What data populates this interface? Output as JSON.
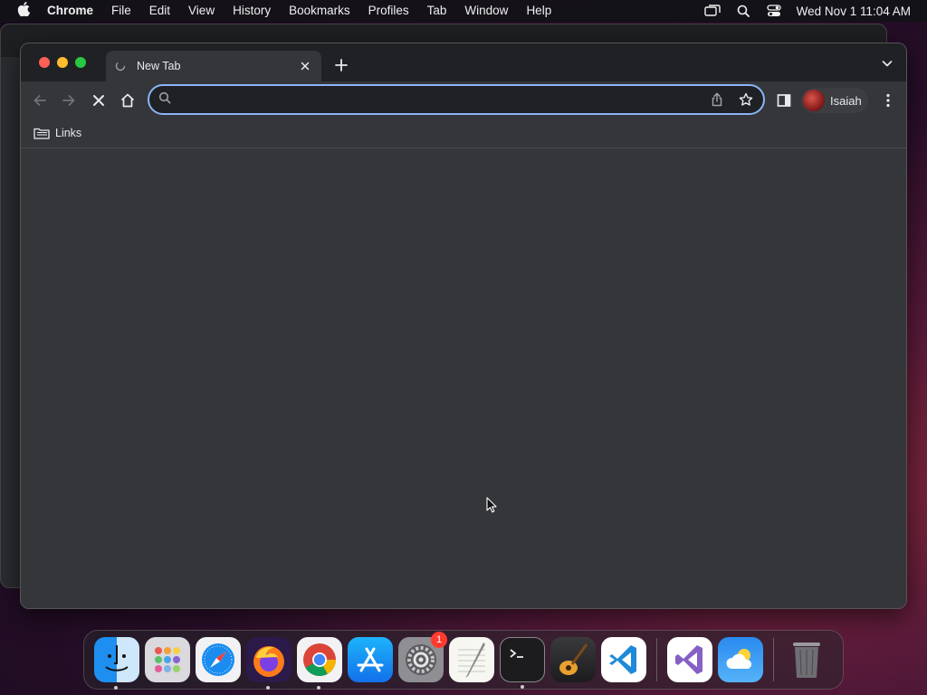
{
  "menubar": {
    "app_name": "Chrome",
    "items": [
      "File",
      "Edit",
      "View",
      "History",
      "Bookmarks",
      "Profiles",
      "Tab",
      "Window",
      "Help"
    ],
    "clock": "Wed Nov 1  11:04 AM"
  },
  "tab": {
    "title": "New Tab"
  },
  "omnibox": {
    "value": "",
    "placeholder": ""
  },
  "profile": {
    "name": "Isaiah"
  },
  "bookmarks": {
    "items": [
      {
        "label": "Links"
      }
    ]
  },
  "dock": {
    "apps": [
      {
        "name": "finder",
        "running": true
      },
      {
        "name": "launchpad",
        "running": false
      },
      {
        "name": "safari",
        "running": false
      },
      {
        "name": "firefox",
        "running": true
      },
      {
        "name": "chrome",
        "running": true
      },
      {
        "name": "app-store",
        "running": false
      },
      {
        "name": "system-settings",
        "running": false,
        "badge": "1"
      },
      {
        "name": "textedit",
        "running": false
      },
      {
        "name": "terminal",
        "running": true
      },
      {
        "name": "garageband",
        "running": false
      },
      {
        "name": "vscode",
        "running": false
      }
    ],
    "recent": [
      {
        "name": "visual-studio",
        "running": false
      },
      {
        "name": "weather",
        "running": false
      }
    ],
    "trash": {
      "name": "trash"
    }
  },
  "colors": {
    "accent": "#8ab4f8",
    "toolbar_bg": "#35363a",
    "tabstrip_bg": "#202124"
  }
}
